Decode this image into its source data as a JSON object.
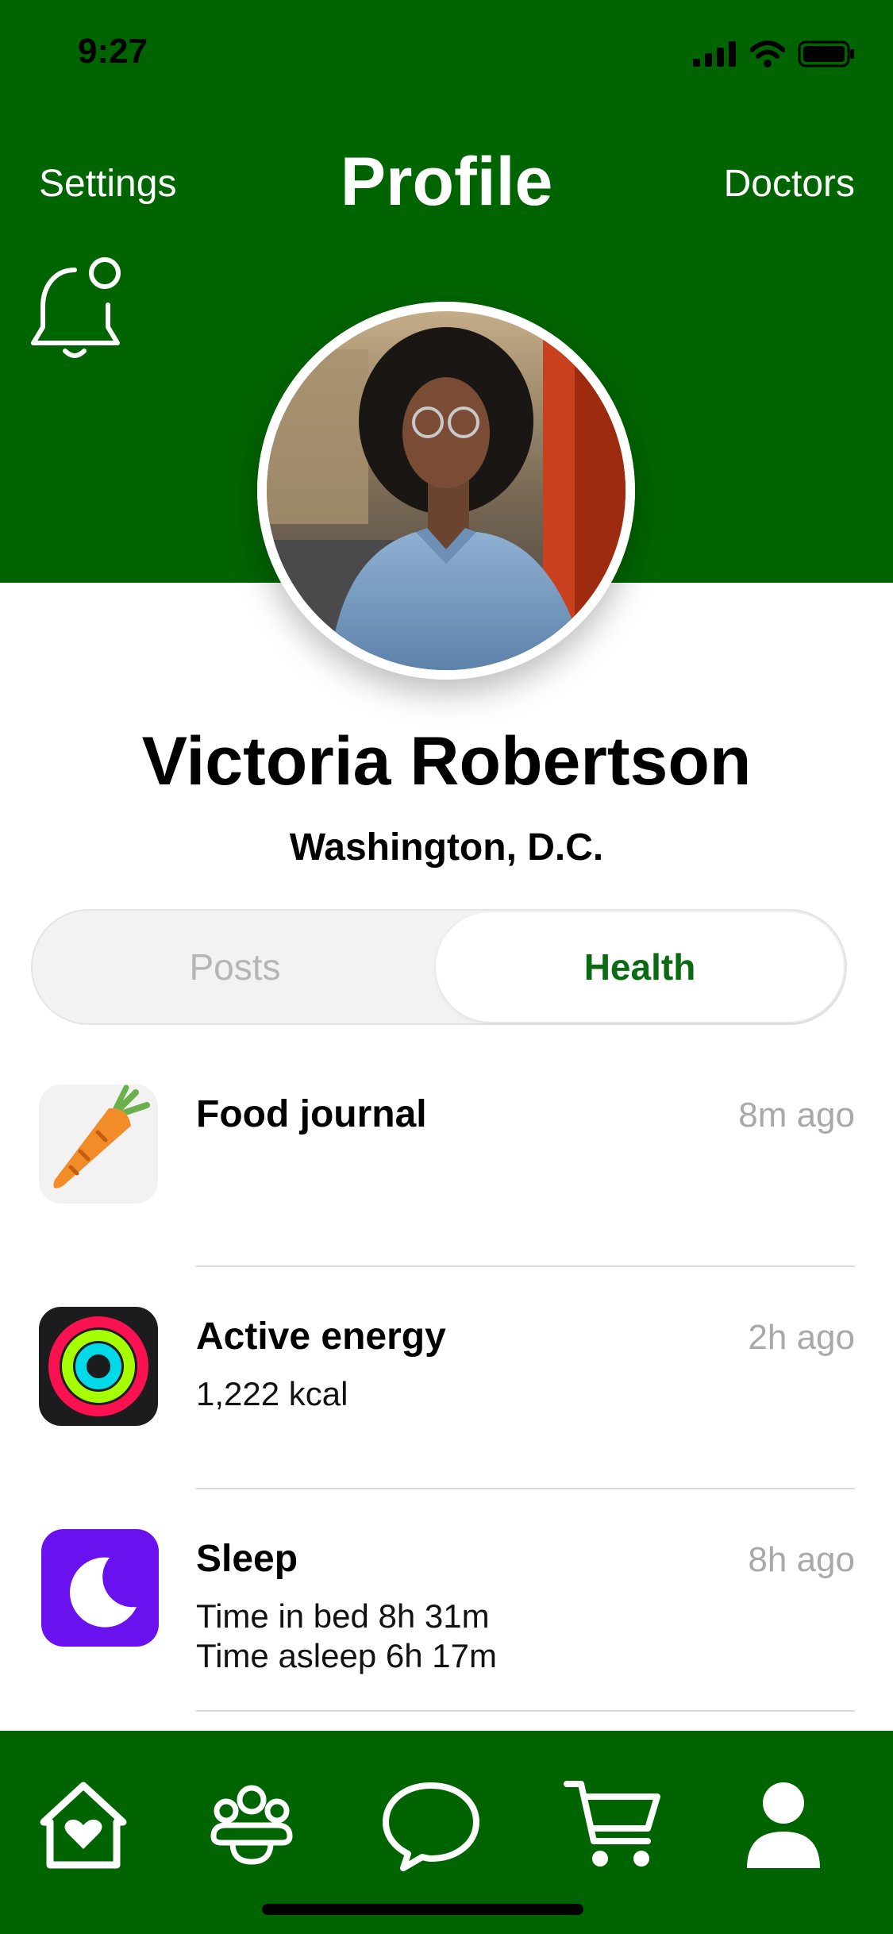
{
  "status_bar": {
    "time": "9:27"
  },
  "header": {
    "title": "Profile",
    "left_action": "Settings",
    "right_action": "Doctors",
    "notification_icon": "bell-icon",
    "color": "#006400"
  },
  "profile": {
    "name": "Victoria Robertson",
    "location": "Washington, D.C."
  },
  "segmented": {
    "options": [
      "Posts",
      "Health"
    ],
    "selected": "Health"
  },
  "health_items": [
    {
      "title": "Food journal",
      "time": "8m ago",
      "details": [],
      "icon": "carrot-icon"
    },
    {
      "title": "Active energy",
      "time": "2h ago",
      "details": [
        "1,222 kcal"
      ],
      "icon": "activity-rings-icon"
    },
    {
      "title": "Sleep",
      "time": "8h ago",
      "details": [
        "Time in bed 8h 31m",
        "Time asleep 6h 17m"
      ],
      "icon": "moon-icon"
    }
  ],
  "tab_bar": {
    "items": [
      {
        "name": "home",
        "icon": "home-heart-icon"
      },
      {
        "name": "community",
        "icon": "people-icon"
      },
      {
        "name": "messages",
        "icon": "chat-bubble-icon"
      },
      {
        "name": "shop",
        "icon": "cart-icon"
      },
      {
        "name": "profile",
        "icon": "person-icon"
      }
    ]
  }
}
